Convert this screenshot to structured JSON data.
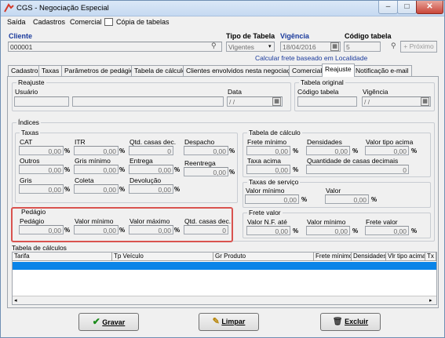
{
  "window": {
    "title": "CGS - Negociação Especial",
    "min": "–",
    "max": "□",
    "close": "✕"
  },
  "menu": [
    "Saída",
    "Cadastros",
    "Comercial",
    "Cópia de tabelas"
  ],
  "header": {
    "cliente_label": "Cliente",
    "cliente_value": "000001",
    "tipo_tabela_label": "Tipo de Tabela",
    "tipo_tabela_value": "Vigentes",
    "vigencia_label": "Vigência",
    "vigencia_value": "18/04/2016",
    "codigo_tabela_label": "Código tabela",
    "codigo_tabela_value": "5",
    "proximo_label": "Próximo",
    "calcular_link": "Calcular frete baseado em Localidade"
  },
  "tabs": [
    "Cadastro",
    "Taxas",
    "Parâmetros de pedágio",
    "Tabela de cálculo",
    "Clientes envolvidos nesta negociação",
    "Comercial",
    "Reajuste",
    "Notificação e-mail"
  ],
  "reajuste": {
    "title": "Reajuste",
    "usuario_label": "Usuário",
    "data_label": "Data",
    "data_value": "/ /"
  },
  "tabela_original": {
    "title": "Tabela original",
    "codigo_label": "Código tabela",
    "vigencia_label": "Vigência",
    "vigencia_value": "/ /"
  },
  "indices": {
    "title": "Índices",
    "taxas": {
      "title": "Taxas",
      "cat": "CAT",
      "itr": "ITR",
      "qtd_casas": "Qtd. casas dec.",
      "despacho": "Despacho",
      "outros": "Outros",
      "gris_minimo": "Gris mínimo",
      "entrega": "Entrega",
      "reentrega": "Reentrega",
      "gris": "Gris",
      "coleta": "Coleta",
      "devolucao": "Devolução",
      "zero": "0,00",
      "zero_int": "0",
      "pct": "%"
    },
    "pedagio": {
      "title": "Pedágio",
      "pedagio": "Pedágio",
      "valor_minimo": "Valor mínimo",
      "valor_maximo": "Valor máximo",
      "qtd_casas": "Qtd. casas dec.",
      "zero": "0,00",
      "zero_int": "0"
    },
    "tabela_calculo": {
      "title": "Tabela de cálculo",
      "frete_minimo": "Frete mínimo",
      "densidades": "Densidades",
      "valor_tipo_acima": "Valor tipo acima",
      "taxa_acima": "Taxa acima",
      "qtd_casas": "Quantidade de casas decimais"
    },
    "taxas_servico": {
      "title": "Taxas de serviço",
      "valor_minimo": "Valor mínimo",
      "valor": "Valor"
    },
    "frete_valor": {
      "title": "Frete valor",
      "valor_nf": "Valor N.F. até",
      "valor_minimo": "Valor mínimo",
      "frete_valor": "Frete valor"
    }
  },
  "tabela_calculos": {
    "title": "Tabela de cálculos",
    "columns": [
      "Tarifa",
      "Tp Veículo",
      "Gr Produto",
      "Frete mínimo",
      "Densidades",
      "Vlr tipo acima",
      "Tx a"
    ]
  },
  "buttons": {
    "gravar": "Gravar",
    "limpar": "Limpar",
    "excluir": "Excluir"
  },
  "colors": {
    "accent": "#1a3a9c",
    "selection": "#0a84e8",
    "highlight": "#d9534f"
  }
}
